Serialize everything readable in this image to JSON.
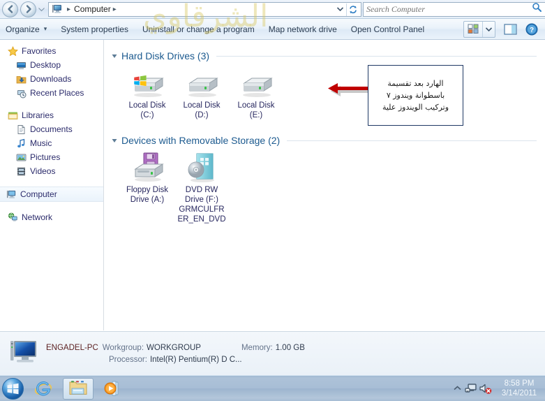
{
  "window": {
    "title": "Computer"
  },
  "address": {
    "back_icon": "back-arrow-icon",
    "forward_icon": "forward-arrow-icon",
    "history_icon": "history-dropdown-icon",
    "crumb_icon": "computer-icon",
    "crumb_label": "Computer",
    "separator": "▸",
    "dropdown_icon": "chevron-down-icon",
    "refresh_icon": "refresh-icon"
  },
  "search": {
    "placeholder": "Search Computer",
    "value": "",
    "icon": "search-icon"
  },
  "toolbar": {
    "organize_label": "Organize",
    "organize_caret": "▾",
    "system_properties_label": "System properties",
    "uninstall_label": "Uninstall or change a program",
    "map_drive_label": "Map network drive",
    "control_panel_label": "Open Control Panel",
    "view_icon": "view-tiles-icon",
    "view_caret_icon": "chevron-down-icon",
    "preview_pane_icon": "preview-pane-icon",
    "help_icon": "help-question-icon"
  },
  "watermark": {
    "text": "الشرقاوي"
  },
  "sidebar": {
    "groups": [
      {
        "name": "favorites",
        "header": {
          "label": "Favorites",
          "icon": "star-icon"
        },
        "items": [
          {
            "label": "Desktop",
            "icon": "desktop-icon"
          },
          {
            "label": "Downloads",
            "icon": "downloads-folder-icon"
          },
          {
            "label": "Recent Places",
            "icon": "recent-places-icon"
          }
        ]
      },
      {
        "name": "libraries",
        "header": {
          "label": "Libraries",
          "icon": "libraries-icon"
        },
        "items": [
          {
            "label": "Documents",
            "icon": "documents-icon"
          },
          {
            "label": "Music",
            "icon": "music-note-icon"
          },
          {
            "label": "Pictures",
            "icon": "pictures-icon"
          },
          {
            "label": "Videos",
            "icon": "videos-film-icon"
          }
        ]
      }
    ],
    "computer": {
      "label": "Computer",
      "icon": "computer-icon",
      "selected": true
    },
    "network": {
      "label": "Network",
      "icon": "network-icon"
    }
  },
  "content": {
    "groups": [
      {
        "name": "hard-disk-drives",
        "title": "Hard Disk Drives (3)",
        "collapse_icon": "triangle-down-icon",
        "items": [
          {
            "name": "local-disk-c",
            "line1": "Local Disk",
            "line2": "(C:)",
            "line3": "",
            "icon": "hard-drive-windows-icon"
          },
          {
            "name": "local-disk-d",
            "line1": "Local Disk",
            "line2": "(D:)",
            "line3": "",
            "icon": "hard-drive-icon"
          },
          {
            "name": "local-disk-e",
            "line1": "Local Disk",
            "line2": "(E:)",
            "line3": "",
            "icon": "hard-drive-icon"
          }
        ]
      },
      {
        "name": "devices-with-removable-storage",
        "title": "Devices with Removable Storage (2)",
        "collapse_icon": "triangle-down-icon",
        "items": [
          {
            "name": "floppy-disk-a",
            "line1": "Floppy Disk",
            "line2": "Drive (A:)",
            "line3": "",
            "icon": "floppy-drive-icon"
          },
          {
            "name": "dvd-rw-f",
            "line1": "DVD RW",
            "line2": "Drive (F:)",
            "line3": "GRMCULFR\nER_EN_DVD",
            "icon": "dvd-drive-icon"
          }
        ]
      }
    ]
  },
  "annotation": {
    "text": "الهارد بعد تقسيمة\nباسطوانة ويندوز ٧\nوتركيب الويندوز علية",
    "arrow_icon": "left-arrow-annotation",
    "arrow_color": "#c00000",
    "border_color": "#1f3864"
  },
  "statusbar": {
    "icon": "computer-large-icon",
    "computer_name": "ENGADEL-PC",
    "workgroup_key": "Workgroup:",
    "workgroup_value": "WORKGROUP",
    "processor_key": "Processor:",
    "processor_value": "Intel(R) Pentium(R) D C...",
    "memory_key": "Memory:",
    "memory_value": "1.00 GB"
  },
  "taskbar": {
    "start_icon": "windows-start-orb",
    "tasks": [
      {
        "name": "internet-explorer",
        "icon": "internet-explorer-icon",
        "active": false
      },
      {
        "name": "windows-explorer",
        "icon": "folder-explorer-icon",
        "active": true
      },
      {
        "name": "windows-media-player",
        "icon": "media-player-icon",
        "active": false
      }
    ],
    "tray": [
      {
        "name": "show-hidden-icons",
        "icon": "chevron-up-icon"
      },
      {
        "name": "network-status",
        "icon": "network-tray-icon"
      },
      {
        "name": "volume-muted",
        "icon": "speaker-muted-icon"
      }
    ],
    "clock_time": "8:58 PM",
    "clock_date": "3/14/2011"
  }
}
